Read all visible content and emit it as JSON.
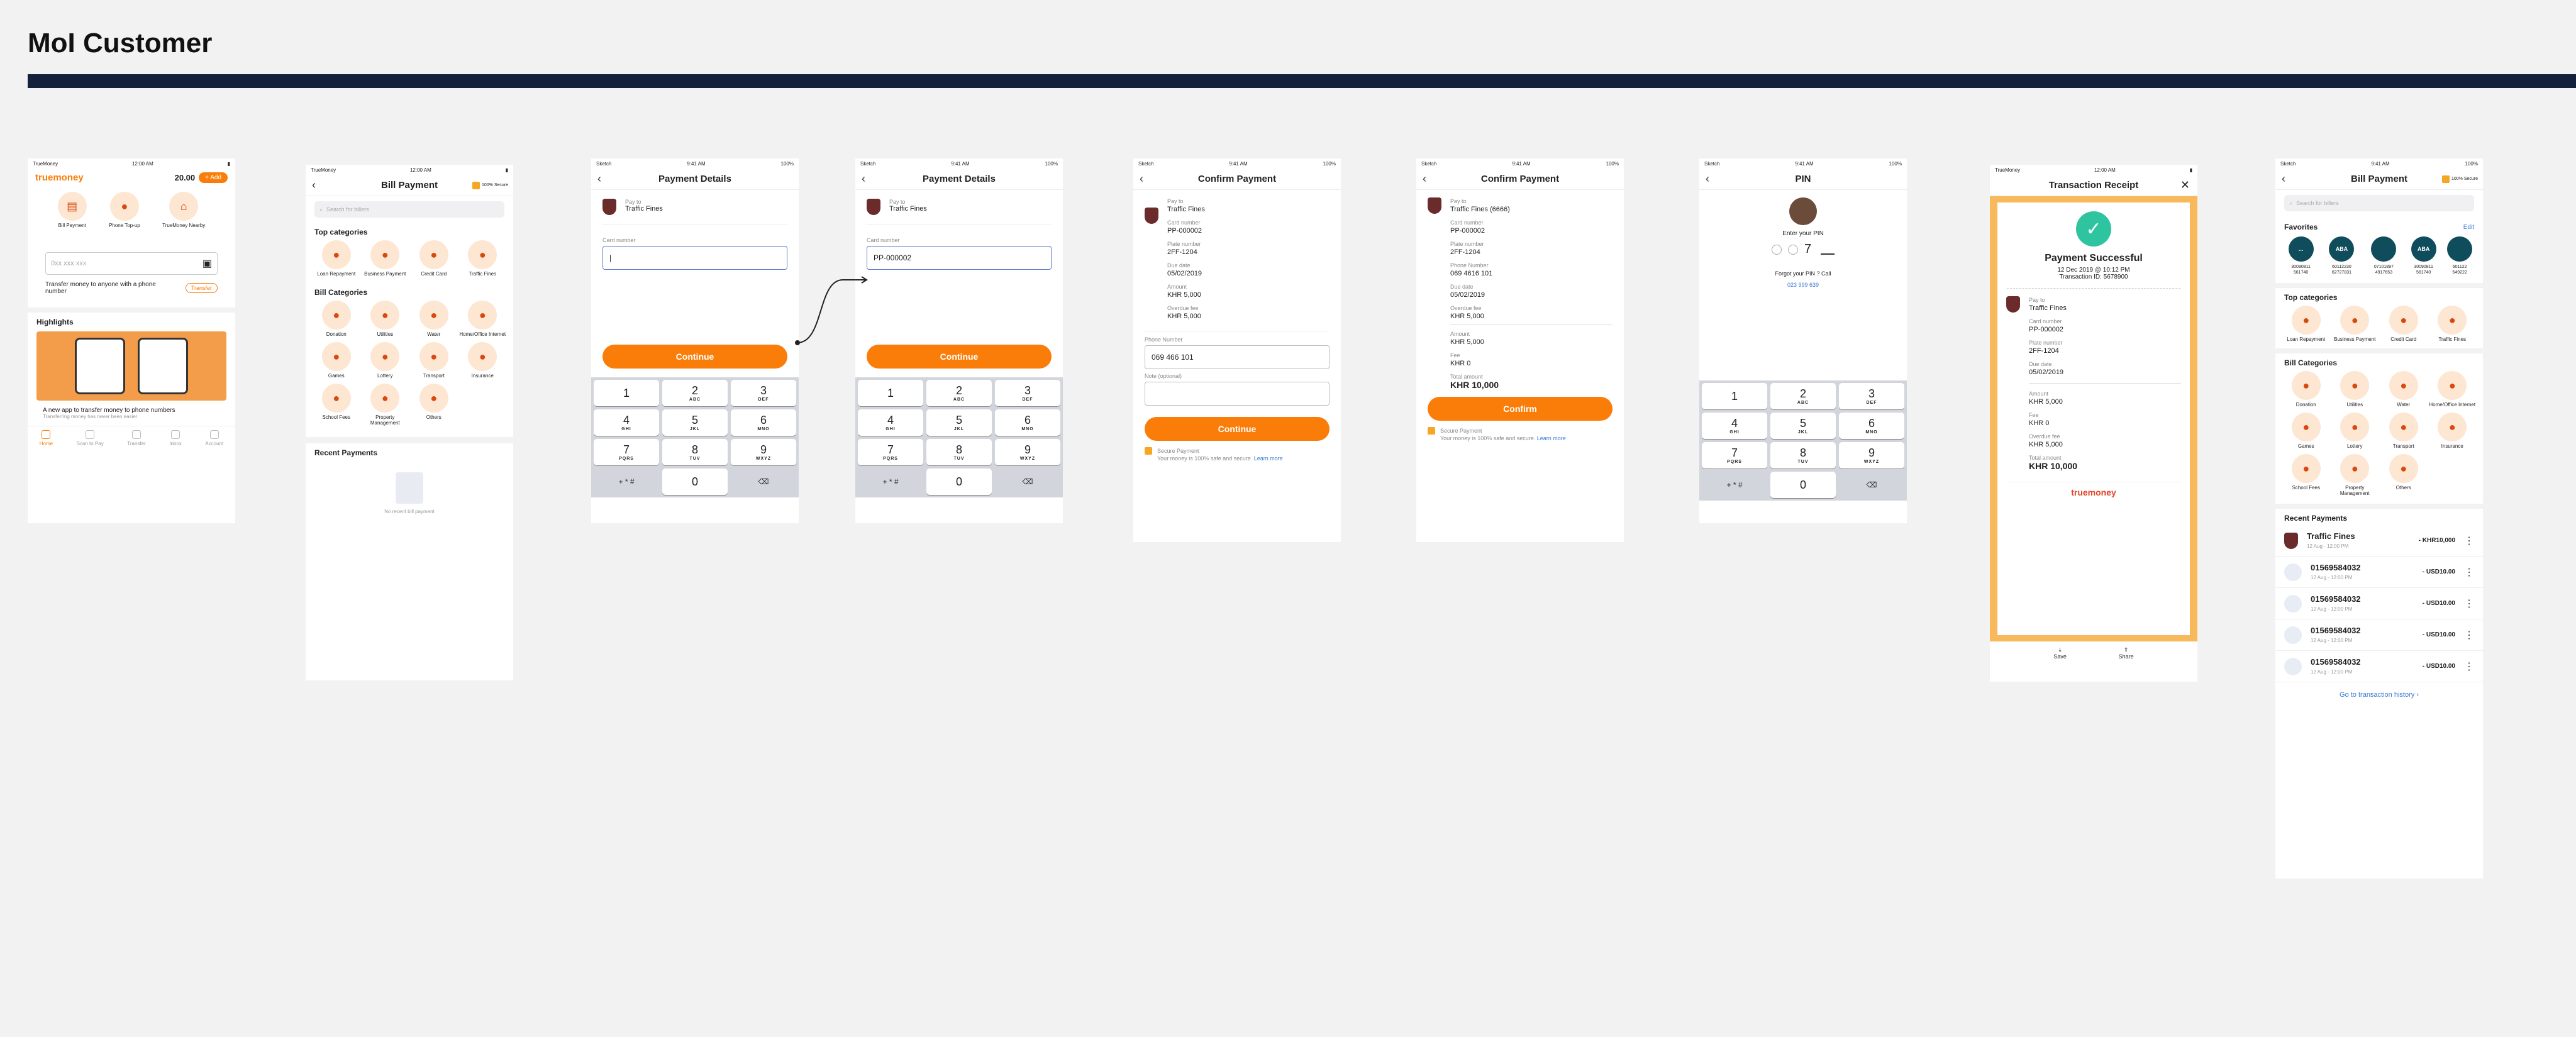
{
  "board": {
    "title": "MoI Customer"
  },
  "status": {
    "time_a": "12:00 AM",
    "time_b": "9:41 AM",
    "carrier_a": "TrueMoney",
    "carrier_b": "Sketch",
    "battery": "100%"
  },
  "home": {
    "logo": "truemoney",
    "balance": "20.00",
    "add": "+ Add",
    "shortcuts": [
      "Bill Payment",
      "Phone Top-up",
      "TrueMoney Nearby"
    ],
    "phone_placeholder": "0xx xxx xxx",
    "transfer_text": "Transfer money to anyone with a phone number",
    "transfer_btn": "Transfer",
    "highlights": "Highlights",
    "promo_title": "A new app to transfer money to phone numbers",
    "promo_sub": "Transferring money has never been easier",
    "tabs": [
      "Home",
      "Scan to Pay",
      "Transfer",
      "Inbox",
      "Account"
    ]
  },
  "bill1": {
    "title": "Bill Payment",
    "secure": "100% Secure",
    "search": "Search for billers",
    "top_h": "Top categories",
    "top": [
      "Loan Repayment",
      "Business Payment",
      "Credit Card",
      "Traffic Fines"
    ],
    "bill_h": "Bill Categories",
    "bills": [
      "Donation",
      "Utilities",
      "Water",
      "Home/Office Internet",
      "Games",
      "Lottery",
      "Transport",
      "Insurance",
      "School Fees",
      "Property Management",
      "Others"
    ],
    "recent_h": "Recent Payments",
    "recent_empty": "No recent bill payment"
  },
  "pd": {
    "title": "Payment Details",
    "pay_to": "Pay to",
    "biller": "Traffic Fines",
    "card_label": "Card number",
    "card_value": "PP-000002",
    "continue": "Continue"
  },
  "keypad": [
    {
      "n": "1",
      "l": ""
    },
    {
      "n": "2",
      "l": "ABC"
    },
    {
      "n": "3",
      "l": "DEF"
    },
    {
      "n": "4",
      "l": "GHI"
    },
    {
      "n": "5",
      "l": "JKL"
    },
    {
      "n": "6",
      "l": "MNO"
    },
    {
      "n": "7",
      "l": "PQRS"
    },
    {
      "n": "8",
      "l": "TUV"
    },
    {
      "n": "9",
      "l": "WXYZ"
    }
  ],
  "keypad_extra": {
    "sym": "+ * #",
    "zero": "0"
  },
  "cp": {
    "title": "Confirm Payment",
    "pay_to": "Pay to",
    "biller": "Traffic Fines",
    "biller2": "Traffic Fines (6666)",
    "card_l": "Card number",
    "card_v": "PP-000002",
    "plate_l": "Plate number",
    "plate_v": "2FF-1204",
    "due_l": "Due date",
    "due_v": "05/02/2019",
    "amount_l": "Amount",
    "amount_v": "KHR 5,000",
    "over_l": "Overdue fee",
    "over_v": "KHR 5,000",
    "phone_l": "Phone Number",
    "phone_v": "069 466 101",
    "phone_v2": "069 4616 101",
    "note_l": "Note (optional)",
    "fee_l": "Fee",
    "fee_v": "KHR 0",
    "total_l": "Total amount",
    "total_v": "KHR 10,000",
    "continue": "Continue",
    "confirm": "Confirm",
    "secure_h": "Secure Payment",
    "secure_t": "Your money is 100% safe and secure.",
    "learn": "Learn more"
  },
  "pin": {
    "title": "PIN",
    "enter": "Enter your PIN",
    "digit": "7",
    "forgot": "Forgot your PIN ? Call",
    "phone": "023 999 639"
  },
  "receipt": {
    "title": "Transaction Receipt",
    "success": "Payment Successful",
    "date": "12 Dec 2019 @ 10:12 PM",
    "txid": "Transaction ID: 5678900",
    "brand": "truemoney",
    "save": "Save",
    "share": "Share"
  },
  "bill2": {
    "fav_h": "Favorites",
    "edit": "Edit",
    "favs": [
      {
        "logo": "...",
        "n": "30090811 561740"
      },
      {
        "logo": "ABA",
        "n": "60112230 62727831"
      },
      {
        "logo": "",
        "n": "07101897 4917653"
      },
      {
        "logo": "ABA",
        "n": "30090811 561740"
      },
      {
        "logo": "",
        "n": "601122 549222"
      }
    ],
    "recent": [
      {
        "t": "Traffic Fines",
        "d": "12 Aug - 12:00 PM",
        "a": "- KHR10,000"
      },
      {
        "t": "01569584032",
        "d": "12 Aug - 12:00 PM",
        "a": "- USD10.00"
      },
      {
        "t": "01569584032",
        "d": "12 Aug - 12:00 PM",
        "a": "- USD10.00"
      },
      {
        "t": "01569584032",
        "d": "12 Aug - 12:00 PM",
        "a": "- USD10.00"
      },
      {
        "t": "01569584032",
        "d": "12 Aug - 12:00 PM",
        "a": "- USD10.00"
      }
    ],
    "history": "Go to transaction history"
  },
  "colors": {
    "accent": "#fa7d09",
    "navy": "#14213d",
    "link": "#3a7bd5"
  }
}
